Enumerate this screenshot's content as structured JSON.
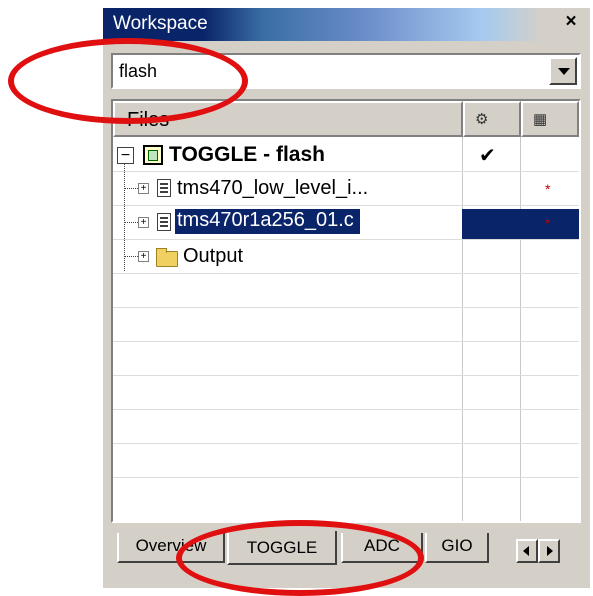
{
  "window": {
    "title": "Workspace",
    "close_glyph": "×"
  },
  "configuration": {
    "value": "flash"
  },
  "columns": {
    "files": "Files",
    "col2_icon": "options-icon",
    "col3_icon": "make-icon"
  },
  "tree": [
    {
      "label": "TOGGLE - flash",
      "type": "project",
      "checked": true,
      "check_glyph": "✔"
    },
    {
      "label": "tms470_low_level_i...",
      "type": "file",
      "modified_glyph": "*"
    },
    {
      "label": "tms470r1a256_01.c",
      "type": "file",
      "selected": true,
      "modified_glyph": "*"
    },
    {
      "label": "Output",
      "type": "folder"
    }
  ],
  "tabs": [
    "Overview",
    "TOGGLE",
    "ADC",
    "GIO"
  ],
  "active_tab": "TOGGLE",
  "colors": {
    "selection": "#0a246a",
    "annotation": "#e01010",
    "face": "#d4d0c8"
  }
}
